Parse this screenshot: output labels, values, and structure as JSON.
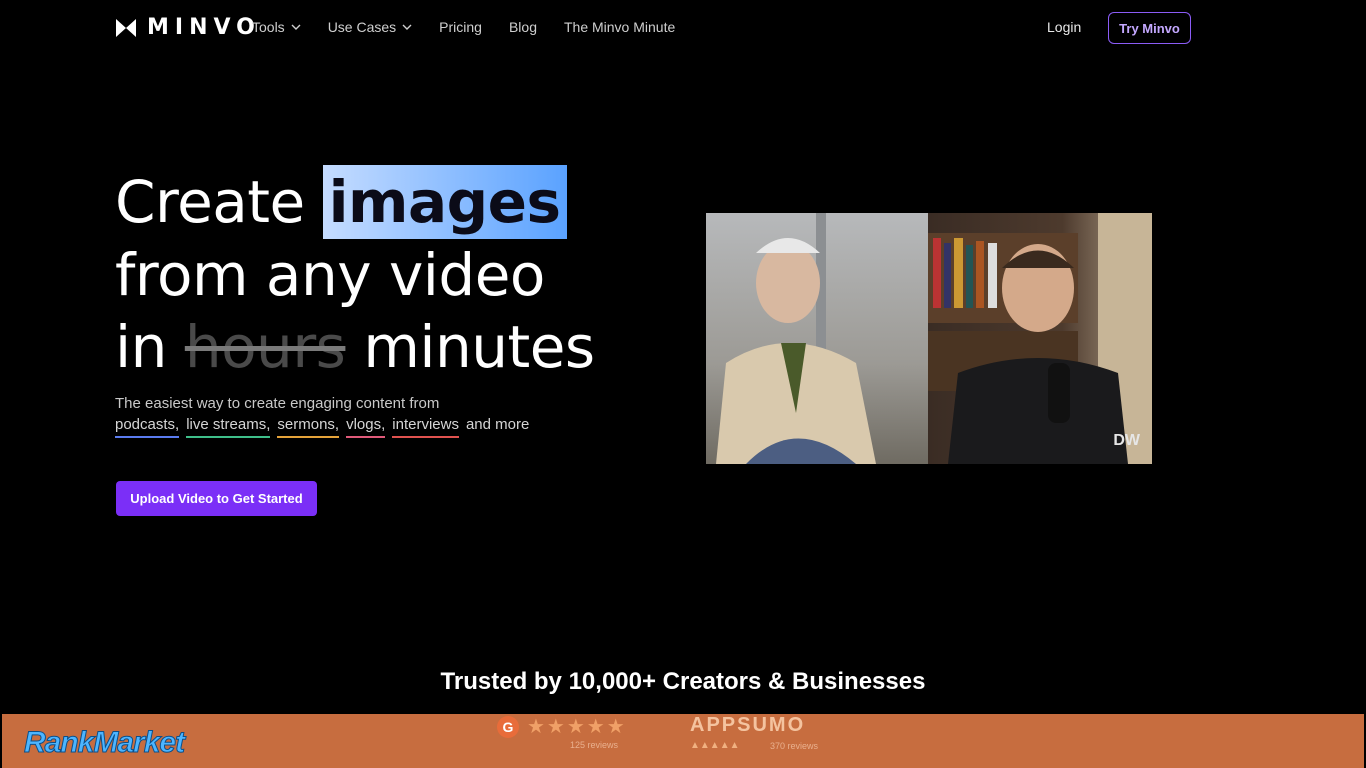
{
  "nav": {
    "logo": "MINVO",
    "links": [
      {
        "label": "Tools",
        "dropdown": true
      },
      {
        "label": "Use Cases",
        "dropdown": true
      },
      {
        "label": "Pricing",
        "dropdown": false
      },
      {
        "label": "Blog",
        "dropdown": false
      },
      {
        "label": "The Minvo Minute",
        "dropdown": false
      }
    ],
    "login": "Login",
    "try": "Try Minvo"
  },
  "hero": {
    "line1_prefix": "Create",
    "line1_highlight": "images",
    "line2": "from any video",
    "line3_prefix": "in",
    "line3_strike": "hours",
    "line3_suffix": "minutes",
    "subtitle": "The easiest way to create engaging content from",
    "tags": [
      {
        "label": "podcasts,",
        "color": "#5b7cf0"
      },
      {
        "label": "live streams,",
        "color": "#3fbf8a"
      },
      {
        "label": "sermons,",
        "color": "#e5a33a"
      },
      {
        "label": "vlogs,",
        "color": "#e05a7a"
      },
      {
        "label": "interviews",
        "color": "#e0524f"
      }
    ],
    "tags_suffix": "and more",
    "cta": "Upload Video to Get Started"
  },
  "video": {
    "watermark": "DW"
  },
  "trusted": "Trusted by 10,000+ Creators & Businesses",
  "banner": {
    "g2_logo": "G",
    "g2_stars": "★★★★★",
    "g2_reviews": "125 reviews",
    "appsumo": "APPSUMO",
    "appsumo_stars": "▲▲▲▲▲",
    "appsumo_reviews": "370 reviews",
    "rankmarket": "RankMarket"
  },
  "colors": {
    "accent": "#7b2ff7",
    "try_border": "#8b5cf6",
    "highlight": "#5aa2ff",
    "banner": "#c76d3f"
  }
}
